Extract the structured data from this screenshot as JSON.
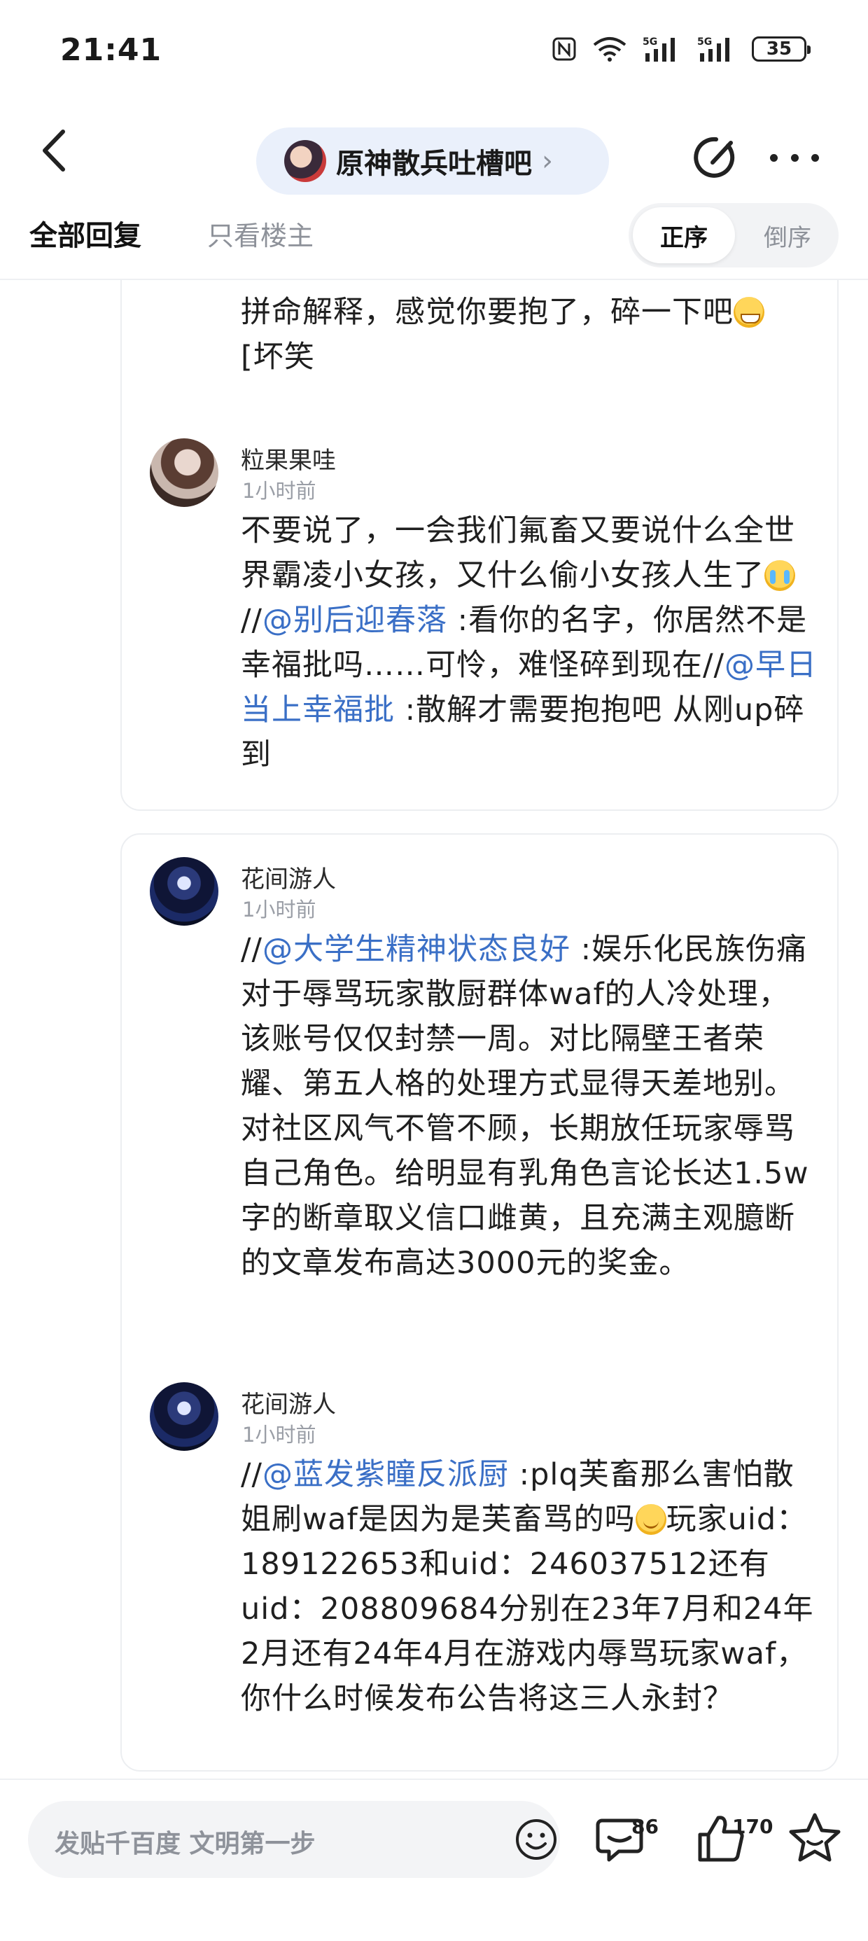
{
  "status_bar": {
    "time": "21:41",
    "battery": "35",
    "icons": [
      "nfc-icon",
      "wifi-icon",
      "5g-signal-icon",
      "5g-signal-icon",
      "battery-icon"
    ]
  },
  "header": {
    "forum_name": "原神散兵吐槽吧",
    "chevron": "›"
  },
  "tabs": {
    "all_replies": "全部回复",
    "op_only": "只看楼主",
    "sort_asc": "正序",
    "sort_desc": "倒序"
  },
  "replies": [
    {
      "partial_text_line1": "拼命解释，感觉你要抱了，碎一下吧",
      "partial_text_line2": "[坏笑"
    },
    {
      "user": "粒果果哇",
      "time": "1小时前",
      "text_a": "不要说了，一会我们氟畜又要说什么全世界霸凌小女孩，又什么偷小女孩人生了",
      "sep1": "//",
      "mention1": "@别后迎春落",
      "text_b": " :看你的名字，你居然不是幸福批吗……可怜，难怪碎到现在//",
      "mention2": "@早日当上幸福批",
      "text_c": " :散解才需要抱抱吧 从刚up碎到"
    },
    {
      "user": "花间游人",
      "time": "1小时前",
      "sep": "//",
      "mention": "@大学生精神状态良好",
      "text": " :娱乐化民族伤痛对于辱骂玩家散厨群体waf的人冷处理， 该账号仅仅封禁一周。对比隔壁王者荣耀、第五人格的处理方式显得天差地别。对社区风气不管不顾，长期放任玩家辱骂自己角色。给明显有乳角色言论长达1.5w字的断章取义信口雌黄，且充满主观臆断的文章发布高达3000元的奖金。"
    },
    {
      "user": "花间游人",
      "time": "1小时前",
      "sep": "//",
      "mention": "@蓝发紫瞳反派厨",
      "text_a": " :plq芙畜那么害怕散姐刷waf是因为是芙畜骂的吗",
      "text_b": "玩家uid：189122653和uid：246037512还有uid：208809684分别在23年7月和24年2月还有24年4月在游戏内辱骂玩家waf，你什么时候发布公告将这三人永封？"
    }
  ],
  "bottom_bar": {
    "input_placeholder": "发贴千百度 文明第一步",
    "comment_count": "86",
    "like_count": "170"
  }
}
